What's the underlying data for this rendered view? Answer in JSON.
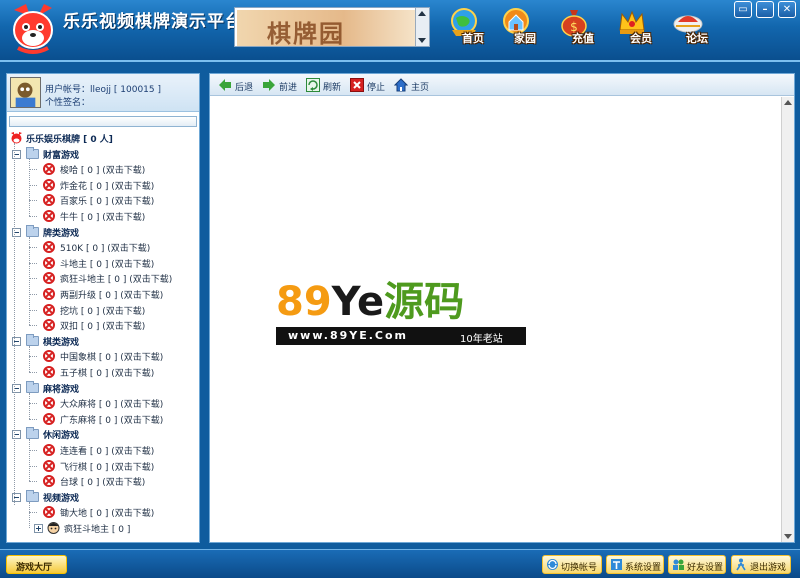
{
  "header": {
    "title": "乐乐视频棋牌演示平台",
    "banner_text": "棋牌园",
    "nav": [
      {
        "label": "首页",
        "icon": "globe-home-icon"
      },
      {
        "label": "家园",
        "icon": "globe-house-icon"
      },
      {
        "label": "充值",
        "icon": "money-bag-icon"
      },
      {
        "label": "会员",
        "icon": "crown-icon"
      },
      {
        "label": "论坛",
        "icon": "cap-forum-icon"
      }
    ],
    "window_controls": [
      "▭",
      "–",
      "✕"
    ]
  },
  "user": {
    "account": "用户帐号：lleojj [ 100015 ]",
    "signature": "个性签名："
  },
  "tree": {
    "root": "乐乐娱乐棋牌 [ 0 人]",
    "categories": [
      {
        "name": "财富游戏",
        "items": [
          "梭哈 [ 0 ] (双击下载)",
          "炸金花 [ 0 ] (双击下载)",
          "百家乐 [ 0 ] (双击下载)",
          "牛牛 [ 0 ] (双击下载)"
        ]
      },
      {
        "name": "牌类游戏",
        "items": [
          "510K [ 0 ] (双击下载)",
          "斗地主 [ 0 ] (双击下载)",
          "疯狂斗地主 [ 0 ] (双击下载)",
          "两副升级 [ 0 ] (双击下载)",
          "挖坑 [ 0 ] (双击下载)",
          "双扣 [ 0 ] (双击下载)"
        ]
      },
      {
        "name": "棋类游戏",
        "items": [
          "中国象棋 [ 0 ] (双击下载)",
          "五子棋 [ 0 ] (双击下载)"
        ]
      },
      {
        "name": "麻将游戏",
        "items": [
          "大众麻将 [ 0 ] (双击下载)",
          "广东麻将 [ 0 ] (双击下载)"
        ]
      },
      {
        "name": "休闲游戏",
        "items": [
          "连连看 [ 0 ] (双击下载)",
          "飞行棋 [ 0 ] (双击下载)",
          "台球 [ 0 ] (双击下载)"
        ]
      },
      {
        "name": "视频游戏",
        "items": [
          "锄大地 [ 0 ] (双击下载)"
        ],
        "extra": "疯狂斗地主 [ 0 ]"
      }
    ]
  },
  "browser_toolbar": {
    "back": "后退",
    "forward": "前进",
    "refresh": "刷新",
    "stop": "停止",
    "home": "主页"
  },
  "watermark": {
    "part_89": "89",
    "part_ye": "Ye",
    "part_cn": "源码",
    "url": "www.89YE.Com",
    "tag": "10年老站"
  },
  "bottom": {
    "lobby": "游戏大厅",
    "switch_account": "切换帐号",
    "settings": "系统设置",
    "friends": "好友设置",
    "exit": "退出游戏"
  },
  "colors": {
    "frame_blue": "#0f5c9e",
    "bar_gold": "#f7d870",
    "error_red": "#d62020",
    "wm_orange": "#f59b12",
    "wm_green": "#4e9a1e"
  }
}
